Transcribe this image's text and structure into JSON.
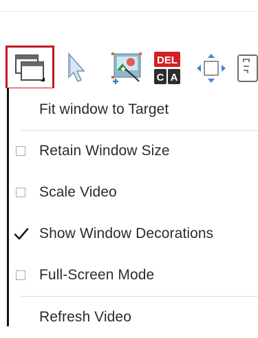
{
  "toolbar": {
    "buttons": [
      {
        "icon": "windows-icon",
        "active": true
      },
      {
        "icon": "cursor-icon",
        "active": false
      },
      {
        "icon": "select-area-icon",
        "active": false
      },
      {
        "icon": "ctrl-alt-del-icon",
        "active": false
      },
      {
        "icon": "move-arrows-icon",
        "active": false
      },
      {
        "icon": "clipboard-icon",
        "active": false
      }
    ],
    "del_key_label": "DEL",
    "c_key_label": "C",
    "a_key_label": "A",
    "active_outline_color": "#c4191f"
  },
  "menu": {
    "items": [
      {
        "label": "Fit window to Target",
        "type": "action"
      },
      {
        "label": "Retain Window Size",
        "type": "checkbox",
        "checked": false
      },
      {
        "label": "Scale Video",
        "type": "checkbox",
        "checked": false
      },
      {
        "label": "Show Window Decorations",
        "type": "checkbox",
        "checked": true
      },
      {
        "label": "Full-Screen Mode",
        "type": "checkbox",
        "checked": false
      },
      {
        "label": "Refresh Video",
        "type": "action"
      }
    ]
  }
}
